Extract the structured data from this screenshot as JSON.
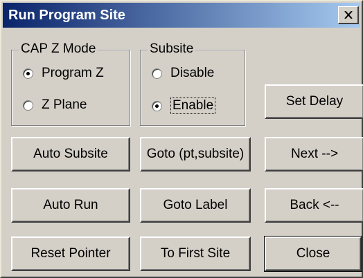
{
  "window": {
    "title": "Run Program Site",
    "close_icon": "close-icon"
  },
  "cap_z_mode": {
    "label": "CAP Z Mode",
    "options": [
      {
        "label": "Program Z",
        "checked": true
      },
      {
        "label": "Z Plane",
        "checked": false
      }
    ]
  },
  "subsite": {
    "label": "Subsite",
    "options": [
      {
        "label": "Disable",
        "checked": false
      },
      {
        "label": "Enable",
        "checked": true
      }
    ]
  },
  "buttons": {
    "set_delay": "Set Delay",
    "auto_subsite": "Auto Subsite",
    "goto_pt_subsite": "Goto (pt,subsite)",
    "next": "Next -->",
    "auto_run": "Auto Run",
    "goto_label": "Goto Label",
    "back": "Back <--",
    "reset_pointer": "Reset Pointer",
    "to_first_site": "To First Site",
    "close": "Close"
  }
}
